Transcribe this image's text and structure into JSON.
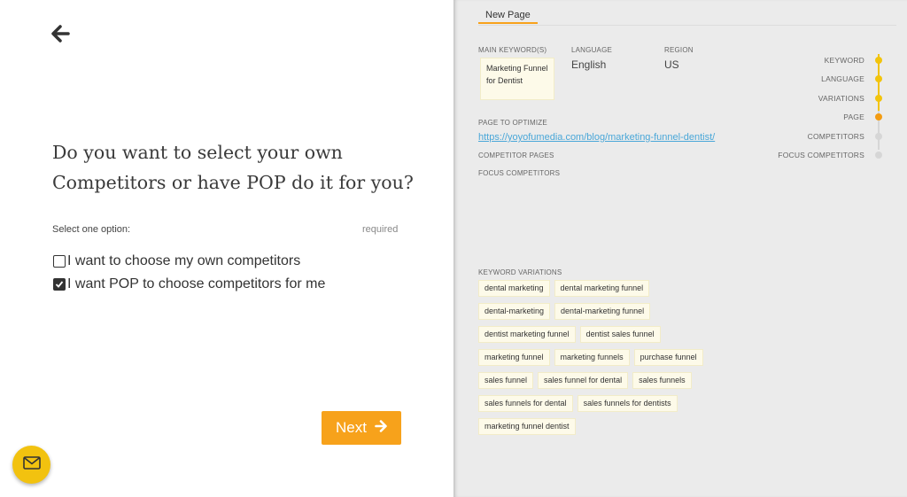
{
  "left": {
    "question": "Do you want to select your own Competitors or have POP do it for you?",
    "select_label": "Select one option:",
    "required_label": "required",
    "options": [
      {
        "label": "I want to choose my own competitors",
        "checked": false
      },
      {
        "label": "I want POP to choose competitors for me",
        "checked": true
      }
    ],
    "next_label": "Next"
  },
  "right": {
    "tab_label": "New Page",
    "main_keyword_label": "MAIN KEYWORD(S)",
    "main_keyword_value": "Marketing Funnel for Dentist",
    "language_label": "LANGUAGE",
    "language_value": "English",
    "region_label": "REGION",
    "region_value": "US",
    "page_to_optimize_label": "PAGE TO OPTIMIZE",
    "page_url": "https://yoyofumedia.com/blog/marketing-funnel-dentist/",
    "competitor_pages_label": "COMPETITOR PAGES",
    "focus_competitors_label": "FOCUS COMPETITORS",
    "keyword_variations_label": "KEYWORD VARIATIONS",
    "keyword_variations": [
      "dental marketing",
      "dental marketing funnel",
      "dental-marketing",
      "dental-marketing funnel",
      "dentist marketing funnel",
      "dentist sales funnel",
      "marketing funnel",
      "marketing funnels",
      "purchase funnel",
      "sales funnel",
      "sales funnel for dental",
      "sales funnels",
      "sales funnels for dental",
      "sales funnels for dentists",
      "marketing funnel dentist"
    ],
    "steps": [
      {
        "label": "KEYWORD",
        "state": "done"
      },
      {
        "label": "LANGUAGE",
        "state": "done"
      },
      {
        "label": "VARIATIONS",
        "state": "done"
      },
      {
        "label": "PAGE",
        "state": "current"
      },
      {
        "label": "COMPETITORS",
        "state": "pending"
      },
      {
        "label": "FOCUS COMPETITORS",
        "state": "pending"
      }
    ]
  },
  "colors": {
    "accent": "#f7a21b",
    "step_done": "#f2c40c",
    "step_current": "#f39c12",
    "step_pending": "#d6d6d6",
    "chip_bg": "#fdfae9",
    "link": "#4aa7d8",
    "mail_button": "#f2c20f"
  },
  "icons": [
    "back-arrow-icon",
    "checkbox-unchecked-icon",
    "checkbox-checked-icon",
    "arrow-right-icon",
    "mail-icon"
  ]
}
